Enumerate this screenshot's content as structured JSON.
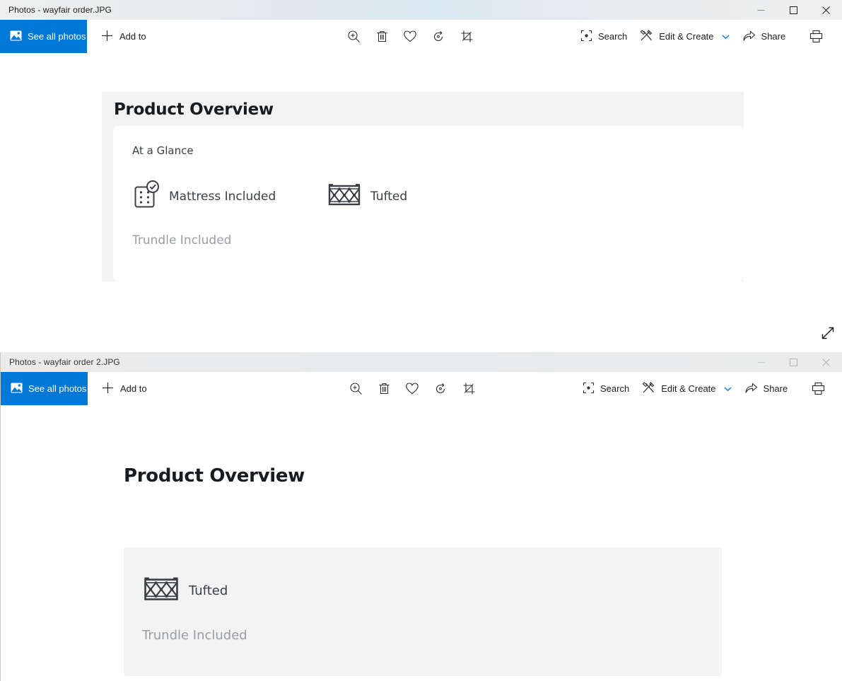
{
  "windows": [
    {
      "id": "window-1",
      "title": "Photos - wayfair order.JPG",
      "active": true,
      "toolbar": {
        "see_all_photos": "See all photos",
        "add_to": "Add to",
        "search": "Search",
        "edit_and_create": "Edit & Create",
        "share": "Share",
        "icons": {
          "see_all_photos": "photos-icon",
          "add_to": "plus-icon",
          "zoom": "zoom-in-icon",
          "delete": "trash-icon",
          "favorite": "heart-icon",
          "rotate": "rotate-icon",
          "crop": "crop-icon",
          "search": "search-focus-icon",
          "edit_create": "edit-create-icon",
          "edit_create_chevron": "chevron-down-icon",
          "share": "share-icon",
          "print": "printer-icon",
          "more": "ellipsis-icon"
        }
      },
      "window_controls": {
        "minimize": "minimize-icon",
        "maximize": "maximize-icon",
        "close": "close-icon"
      },
      "photo": {
        "heading": "Product Overview",
        "section_label": "At a Glance",
        "features": [
          {
            "label": "Mattress Included",
            "icon": "mattress-included-icon"
          },
          {
            "label": "Tufted",
            "icon": "tufted-icon"
          }
        ],
        "note": "Trundle Included"
      },
      "expand_icon": "expand-diagonal-icon"
    },
    {
      "id": "window-2",
      "title": "Photos - wayfair order 2.JPG",
      "active": false,
      "toolbar": {
        "see_all_photos": "See all photos",
        "add_to": "Add to",
        "search": "Search",
        "edit_and_create": "Edit & Create",
        "share": "Share",
        "icons": {
          "see_all_photos": "photos-icon",
          "add_to": "plus-icon",
          "zoom": "zoom-in-icon",
          "delete": "trash-icon",
          "favorite": "heart-icon",
          "rotate": "rotate-icon",
          "crop": "crop-icon",
          "search": "search-focus-icon",
          "edit_create": "edit-create-icon",
          "edit_create_chevron": "chevron-down-icon",
          "share": "share-icon",
          "print": "printer-icon",
          "more": "ellipsis-icon"
        }
      },
      "window_controls": {
        "minimize": "minimize-icon",
        "maximize": "maximize-icon",
        "close": "close-icon"
      },
      "photo": {
        "heading": "Product Overview",
        "features": [
          {
            "label": "Tufted",
            "icon": "tufted-icon"
          }
        ],
        "note": "Trundle Included"
      }
    }
  ],
  "colors": {
    "accent": "#0078d7",
    "titlebar": "#eceef0",
    "panel_bg": "#f3f3f4",
    "heading": "#191c1f",
    "body_text": "#3b3f43",
    "muted_text": "#9a9da1"
  }
}
